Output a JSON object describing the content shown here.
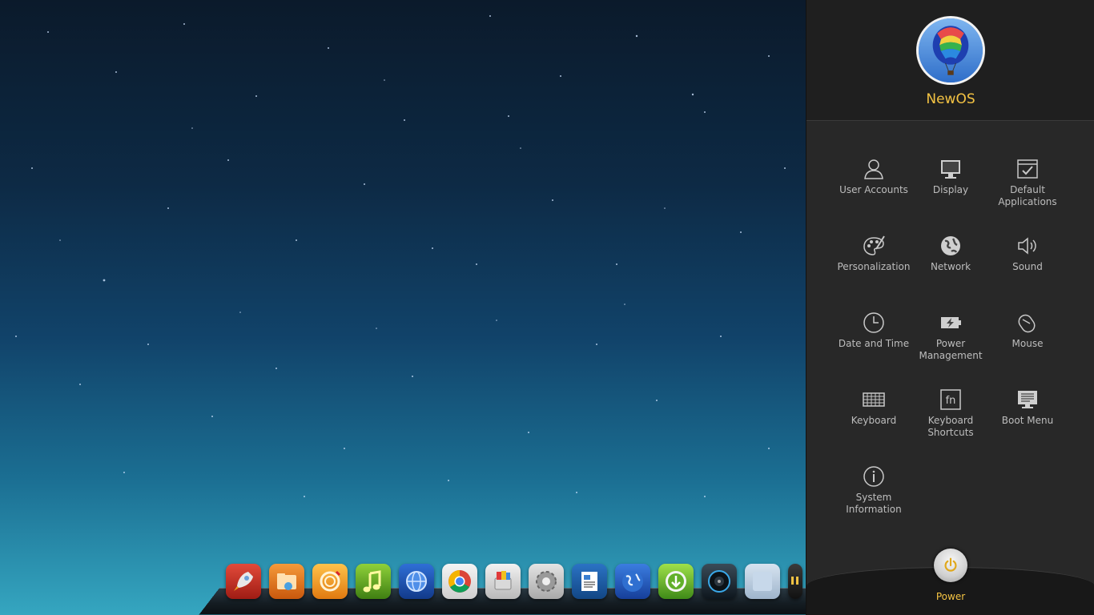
{
  "user": {
    "name": "NewOS",
    "avatar_icon": "hot-air-balloon-icon"
  },
  "settings": [
    {
      "label": "User Accounts",
      "icon": "user-icon"
    },
    {
      "label": "Display",
      "icon": "monitor-icon"
    },
    {
      "label": "Default\nApplications",
      "icon": "default-apps-icon"
    },
    {
      "label": "Personalization",
      "icon": "palette-icon"
    },
    {
      "label": "Network",
      "icon": "globe-icon"
    },
    {
      "label": "Sound",
      "icon": "speaker-icon"
    },
    {
      "label": "Date and Time",
      "icon": "clock-icon"
    },
    {
      "label": "Power\nManagement",
      "icon": "battery-icon"
    },
    {
      "label": "Mouse",
      "icon": "mouse-icon"
    },
    {
      "label": "Keyboard",
      "icon": "keyboard-icon"
    },
    {
      "label": "Keyboard\nShortcuts",
      "icon": "fn-key-icon"
    },
    {
      "label": "Boot Menu",
      "icon": "boot-menu-icon"
    },
    {
      "label": "System\nInformation",
      "icon": "info-icon"
    }
  ],
  "power": {
    "label": "Power",
    "icon": "power-icon"
  },
  "dock": {
    "apps": [
      {
        "name": "launcher",
        "icon": "rocket-icon",
        "color": "#c8281e"
      },
      {
        "name": "file-manager",
        "icon": "folder-icon",
        "color": "#e0761c"
      },
      {
        "name": "browser",
        "icon": "swirl-icon",
        "color": "#f0a020"
      },
      {
        "name": "music",
        "icon": "music-note-icon",
        "color": "#5fa322"
      },
      {
        "name": "web",
        "icon": "globe-icon",
        "color": "#1d4fb0"
      },
      {
        "name": "chrome",
        "icon": "chrome-icon",
        "color": "#e8e8e8"
      },
      {
        "name": "software-center",
        "icon": "box-icon",
        "color": "#dcdcdc"
      },
      {
        "name": "settings",
        "icon": "gear-icon",
        "color": "#c9c9c9"
      },
      {
        "name": "text-editor",
        "icon": "document-icon",
        "color": "#1b5fa8"
      },
      {
        "name": "internet",
        "icon": "earth-icon",
        "color": "#2a5fc0"
      },
      {
        "name": "downloader",
        "icon": "download-icon",
        "color": "#6cb82a"
      },
      {
        "name": "media-player",
        "icon": "disc-icon",
        "color": "#1a2a36"
      },
      {
        "name": "blank-app",
        "icon": "window-icon",
        "color": "#b8cbe0"
      },
      {
        "name": "clock",
        "icon": "clock-app-icon",
        "color": "#222222"
      }
    ]
  },
  "colors": {
    "accent": "#f4c343",
    "panel_bg": "#282828",
    "label": "#bdbdbd"
  }
}
